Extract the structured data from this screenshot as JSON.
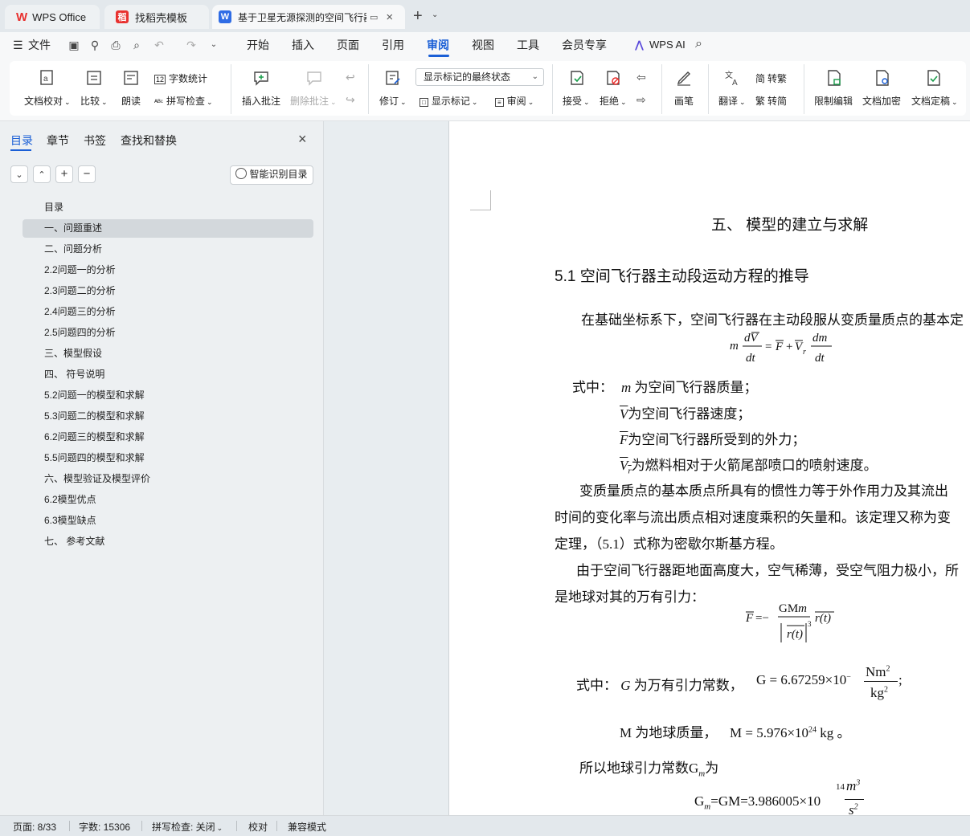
{
  "tabs": [
    {
      "label": "WPS Office",
      "icon": "wps-logo-icon"
    },
    {
      "label": "找稻壳模板",
      "icon": "docer-icon"
    },
    {
      "label": "基于卫星无源探测的空间飞行器",
      "icon": "wps-writer-icon"
    }
  ],
  "menu": {
    "file": "文件",
    "items": [
      "开始",
      "插入",
      "页面",
      "引用",
      "审阅",
      "视图",
      "工具",
      "会员专享"
    ],
    "active": "审阅",
    "ai": "WPS AI"
  },
  "ribbon": {
    "proofread": "文档校对",
    "compare": "比较",
    "read_aloud": "朗读",
    "word_count": "字数统计",
    "spell_check": "拼写检查",
    "insert_comment": "插入批注",
    "delete_comment": "删除批注",
    "revise": "修订",
    "markup_select": "显示标记的最终状态",
    "show_markup": "显示标记",
    "review": "审阅",
    "accept": "接受",
    "reject": "拒绝",
    "pen": "画笔",
    "translate": "翻译",
    "to_traditional": "转繁",
    "to_simplified": "转简",
    "restrict_edit": "限制编辑",
    "encrypt": "文档加密",
    "finalize": "文档定稿"
  },
  "sidebar": {
    "tabs": [
      "目录",
      "章节",
      "书签",
      "查找和替换"
    ],
    "smart_toc": "智能识别目录",
    "toc": [
      "目录",
      "一、问题重述",
      "二、问题分析",
      "2.2问题一的分析",
      "2.3问题二的分析",
      "2.4问题三的分析",
      "2.5问题四的分析",
      "三、模型假设",
      "四、 符号说明",
      "5.2问题一的模型和求解",
      "5.3问题二的模型和求解",
      "6.2问题三的模型和求解",
      "5.5问题四的模型和求解",
      "六、模型验证及模型评价",
      "6.2模型优点",
      "6.3模型缺点",
      "七、 参考文献"
    ],
    "selected_index": 1
  },
  "doc": {
    "chapter_title": "五、 模型的建立与求解",
    "section_title": "5.1  空间飞行器主动段运动方程的推导",
    "para1": "在基础坐标系下，空间飞行器在主动段服从变质量质点的基本定",
    "where_label": "式中：",
    "def1": "为空间飞行器质量；",
    "def2": "为空间飞行器速度；",
    "def3": "为空间飞行器所受到的外力；",
    "def4": "为燃料相对于火箭尾部喷口的喷射速度。",
    "para2_l1": "变质量质点的基本质点所具有的惯性力等于外作用力及其流出",
    "para2_l2": "时间的变化率与流出质点相对速度乘积的矢量和。该定理又称为变",
    "para2_l3": "定理，（5.1）式称为密歇尔斯基方程。",
    "para3_l1": "由于空间飞行器距地面高度大，空气稀薄，受空气阻力极小，所",
    "para3_l2": "是地球对其的万有引力：",
    "g_def": "为万有引力常数，",
    "g_value": "G = 6.67259×10",
    "g_exp": "−",
    "g_unit_num": "Nm",
    "g_unit_den": "kg",
    "m_def": "M 为地球质量，",
    "m_value": "M = 5.976×10",
    "m_exp": "24",
    "m_unit": "kg 。",
    "gm_intro": "所以地球引力常数G",
    "gm_intro_after": "为",
    "gm_value": "=GM=3.986005×10",
    "gm_exp": "14"
  },
  "status": {
    "page": "页面: 8/33",
    "words": "字数: 15306",
    "spell": "拼写检查: 关闭",
    "proof": "校对",
    "compat": "兼容模式"
  },
  "colors": {
    "accent": "#1a5fd6",
    "wps_red": "#e8312f"
  }
}
